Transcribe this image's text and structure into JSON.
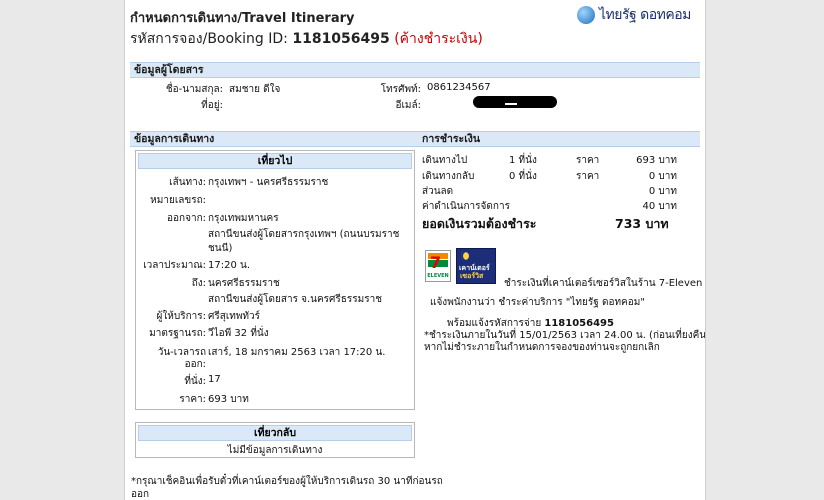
{
  "header": {
    "title": "กำหนดการเดินทาง/Travel Itinerary",
    "booking_prefix": "รหัสการจอง/Booking ID:",
    "booking_id": "1181056495",
    "status": "(ค้างชำระเงิน)",
    "logo_text": "ไทยรัฐ ดอทคอม"
  },
  "passenger": {
    "section_title": "ข้อมูลผู้โดยสาร",
    "name_label": "ชื่อ-นามสกุล:",
    "name_value": "สมชาย ดีใจ",
    "address_label": "ที่อยู่:",
    "phone_label": "โทรศัพท์:",
    "phone_value": "0861234567",
    "email_label": "อีเมล์:"
  },
  "trip": {
    "section_title": "ข้อมูลการเดินทาง",
    "outbound_title": "เที่ยวไป",
    "rows": [
      {
        "label": "เส้นทาง:",
        "value": "กรุงเทพฯ - นครศรีธรรมราช"
      },
      {
        "label": "หมายเลขรถ:",
        "value": ""
      },
      {
        "label": "ออกจาก:",
        "value": "กรุงเทพมหานคร"
      },
      {
        "label": "",
        "value": "สถานีขนส่งผู้โดยสารกรุงเทพฯ (ถนนบรมราช"
      },
      {
        "label": "",
        "value": "ชนนี)"
      },
      {
        "label": "เวลาประมาณ:",
        "value": "17:20 น."
      },
      {
        "label": "ถึง:",
        "value": "นครศรีธรรมราช"
      },
      {
        "label": "",
        "value": "สถานีขนส่งผู้โดยสาร จ.นครศรีธรรมราช"
      },
      {
        "label": "ผู้ให้บริการ:",
        "value": "ศรีสุเทพทัวร์"
      },
      {
        "label": "มาตรฐานรถ:",
        "value": "วีไอพี 32 ที่นั่ง"
      },
      {
        "label": "วัน-เวลารถ",
        "value": "เสาร์, 18 มกราคม 2563 เวลา 17:20 น."
      },
      {
        "label": "ออก:",
        "value": ""
      },
      {
        "label": "ที่นั่ง:",
        "value": "17"
      },
      {
        "label": "ราคา:",
        "value": "693 บาท"
      }
    ],
    "return_title": "เที่ยวกลับ",
    "return_none": "ไม่มีข้อมูลการเดินทาง",
    "footnote_1": "*กรุณาเช็คอินเพื่อรับตั๋วที่เคาน์เตอร์ของผู้ให้บริการเดินรถ 30 นาทีก่อนรถ",
    "footnote_2": "ออก"
  },
  "payment": {
    "section_title": "การชำระเงิน",
    "rows": [
      {
        "label": "เดินทางไป",
        "qty": "1 ที่นั่ง",
        "price_label": "ราคา",
        "amount": "693 บาท"
      },
      {
        "label": "เดินทางกลับ",
        "qty": "0 ที่นั่ง",
        "price_label": "ราคา",
        "amount": "0 บาท"
      },
      {
        "label": "ส่วนลด",
        "qty": "",
        "price_label": "",
        "amount": "0 บาท"
      },
      {
        "label": "ค่าดำเนินการจัดการ",
        "qty": "",
        "price_label": "",
        "amount": "40 บาท"
      }
    ],
    "total_label": "ยอดเงินรวมต้องชำระ",
    "total_value": "733 บาท",
    "logo_711_number": "7",
    "logo_711_text": "ELEVEN",
    "logo_cs_line1": "เคาน์เตอร์",
    "logo_cs_line2": "เซอร์วิส",
    "info_1": "ชำระเงินที่เคาน์เตอร์เซอร์วิสในร้าน 7-Eleven",
    "info_2": "แจ้งพนักงานว่า ชำระค่าบริการ \"ไทยรัฐ ดอทคอม\"",
    "info_3_prefix": "พร้อมแจ้งรหัสการจ่าย",
    "info_3_code": "1181056495",
    "info_4": "*ชำระเงินภายในวันที่ 15/01/2563 เวลา 24.00 น. (ก่อนเที่ยงคืน)",
    "info_5": "หากไม่ชำระภายในกำหนดการจองของท่านจะถูกยกเลิก"
  }
}
